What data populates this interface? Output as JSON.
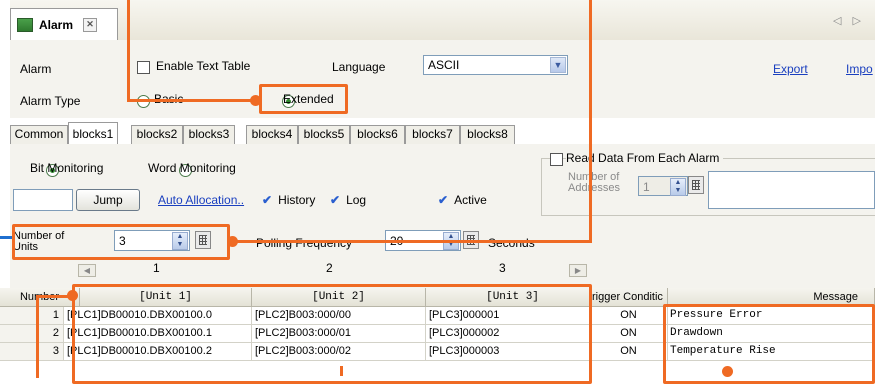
{
  "tab": {
    "title": "Alarm",
    "close": "✕",
    "nav": "◁ ▷"
  },
  "header": {
    "alarm_label": "Alarm",
    "enable_text_table": "Enable Text Table",
    "language_label": "Language",
    "language_value": "ASCII",
    "export_link": "Export",
    "import_link": "Impo",
    "alarm_type_label": "Alarm Type",
    "type_basic": "Basic",
    "type_extended": "Extended"
  },
  "tabs": [
    "Common",
    "blocks1",
    "blocks2",
    "blocks3",
    "blocks4",
    "blocks5",
    "blocks6",
    "blocks7",
    "blocks8"
  ],
  "panel": {
    "bit_monitoring": "Bit Monitoring",
    "word_monitoring": "Word Monitoring",
    "jump_button": "Jump",
    "auto_allocation": "Auto Allocation..",
    "history": "History",
    "log": "Log",
    "active": "Active",
    "read_data_label": "Read Data From Each Alarm",
    "num_addresses_label": "Number of Addresses",
    "num_addresses_value": "1",
    "num_units_label": "Number of Units",
    "num_units_value": "3",
    "polling_label": "Polling Frequency",
    "polling_value": "20",
    "seconds": "Seconds"
  },
  "columns": {
    "c1": "1",
    "c2": "2",
    "c3": "3"
  },
  "table": {
    "headers": {
      "number": "Number",
      "unit1": "[Unit 1]",
      "unit2": "[Unit 2]",
      "unit3": "[Unit 3]",
      "trigger": "rigger Conditic",
      "message": "Message"
    },
    "rows": [
      {
        "num": "1",
        "u1": "[PLC1]DB00010.DBX00100.0",
        "u2": "[PLC2]B003:000/00",
        "u3": "[PLC3]000001",
        "trig": "ON",
        "msg": "Pressure Error"
      },
      {
        "num": "2",
        "u1": "[PLC1]DB00010.DBX00100.1",
        "u2": "[PLC2]B003:000/01",
        "u3": "[PLC3]000002",
        "trig": "ON",
        "msg": "Drawdown"
      },
      {
        "num": "3",
        "u1": "[PLC1]DB00010.DBX00100.2",
        "u2": "[PLC2]B003:000/02",
        "u3": "[PLC3]000003",
        "trig": "ON",
        "msg": "Temperature Rise"
      }
    ]
  },
  "colors": {
    "accent": "#ef6a23",
    "link": "#1a3fbf",
    "check": "#2a5fcf"
  }
}
